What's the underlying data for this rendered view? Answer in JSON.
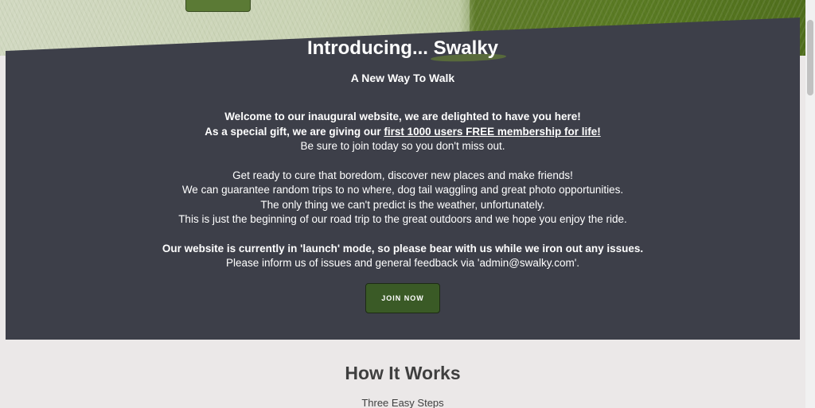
{
  "intro": {
    "title_prefix": "Introducing... ",
    "brand": "Swalky",
    "subtitle": "A New Way To Walk",
    "welcome_line": "Welcome to our inaugural website, we are delighted to have you here!",
    "gift_prefix": "As a special gift, we are giving our ",
    "gift_link": "first 1000 users FREE membership for life!",
    "join_line": "Be sure to join today so you don't miss out.",
    "para2": [
      "Get ready to cure that boredom, discover new places and make friends!",
      "We can guarantee random trips to no where, dog tail waggling and great photo opportunities.",
      "The only thing we can't predict is the weather, unfortunately.",
      "This is just the beginning of our road trip to the great outdoors and we hope you enjoy the ride."
    ],
    "launch_notice": "Our website is currently in 'launch' mode, so please bear with us while we iron out any issues.",
    "feedback_line": "Please inform us of issues and general feedback via 'admin@swalky.com'.",
    "join_button": "JOIN NOW"
  },
  "how_it_works": {
    "title": "How It Works",
    "subtitle": "Three Easy Steps"
  },
  "colors": {
    "intro_background": "#3d3f49",
    "button_green": "#3a5a26",
    "page_background": "#ebe8e8"
  }
}
